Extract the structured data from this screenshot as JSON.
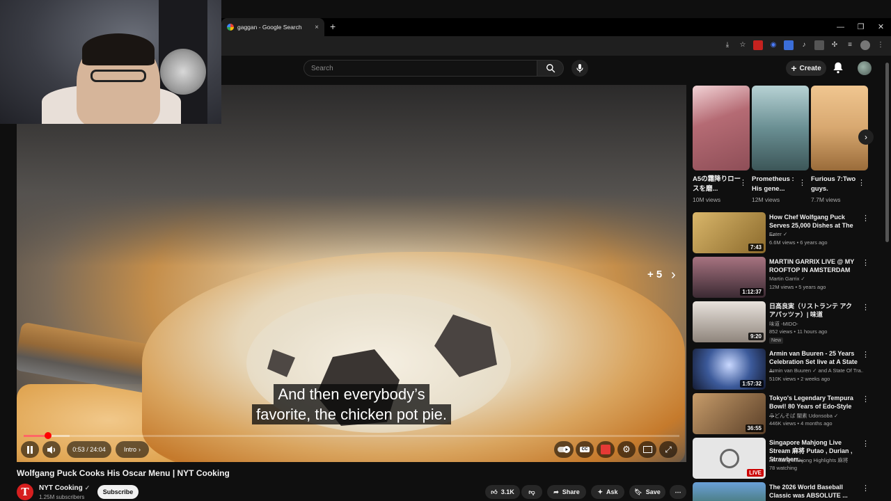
{
  "browser": {
    "tab_title": "gaggan - Google Search",
    "tab_close": "×",
    "new_tab": "+",
    "window_controls": [
      "—",
      "❐",
      "✕"
    ]
  },
  "header": {
    "search_placeholder": "Search",
    "create_label": "Create"
  },
  "player": {
    "caption_line1": "And then everybody’s",
    "caption_line2": "favorite, the chicken pot pie.",
    "plus_count": "+ 5",
    "time": "0:53 / 24:04",
    "chapter": "Intro",
    "progress_fraction": 0.037,
    "loaded_fraction": 0.07
  },
  "video": {
    "title": "Wolfgang Puck Cooks His Oscar Menu | NYT Cooking",
    "channel": "NYT Cooking",
    "channel_logo": "T",
    "subscribers": "1.25M subscribers",
    "subscribe_label": "Subscribe",
    "likes": "3.1K",
    "share_label": "Share",
    "ask_label": "Ask",
    "save_label": "Save"
  },
  "shorts": [
    {
      "title": "A5の霜降りロースを磨...",
      "views": "10M views",
      "color": "#b98a8e"
    },
    {
      "title": "Prometheus : His gene...",
      "views": "12M views",
      "color": "#7fa3a6"
    },
    {
      "title": "Furious 7:Two guys.",
      "views": "7.7M views",
      "color": "#d8a870"
    }
  ],
  "sidebar": [
    {
      "title": "How Chef Wolfgang Puck Serves 25,000 Dishes at The ...",
      "channel": "Eater ✓",
      "meta": "6.6M views • 6 years ago",
      "duration": "7:43",
      "color": "#a5803a"
    },
    {
      "title": "MARTIN GARRIX LIVE @ MY ROOFTOP IN AMSTERDAM",
      "channel": "Martin Garrix ✓",
      "meta": "12M views • 5 years ago",
      "duration": "1:12:37",
      "color": "#6f4a54"
    },
    {
      "title": "日髙良実（リストランテ アクアパッツァ）| 味道",
      "channel": "味道 -MIDO-",
      "meta": "852 views • 11 hours ago",
      "duration": "9:20",
      "badge": "New",
      "color": "#c7bfb8"
    },
    {
      "title": "Armin van Buuren - 25 Years Celebration Set live at A State ...",
      "channel": "Armin van Buuren ✓ and A State Of Tra...",
      "meta": "510K views • 2 weeks ago",
      "duration": "1:57:32",
      "color": "#3f5a8a"
    },
    {
      "title": "Tokyo's Legendary Tempura Bowl! 80 Years of Edo-Style ...",
      "channel": "うどんそば 闇素 Udonsoba ✓",
      "meta": "446K views • 4 months ago",
      "duration": "36:55",
      "color": "#7a5a3c"
    },
    {
      "title": "Singapore Mahjong Live Stream 麻将 Putao , Durian , Strawberr...",
      "channel": "Ah Xiang Mahjong Highlights 麻将",
      "meta": "78 watching",
      "duration": "LIVE",
      "live": true,
      "color": "#e6e6e6"
    },
    {
      "title": "The 2026 World Baseball Classic was ABSOLUTE ...",
      "channel": "",
      "meta": "",
      "duration": "",
      "color": "#4a7ab0"
    }
  ]
}
